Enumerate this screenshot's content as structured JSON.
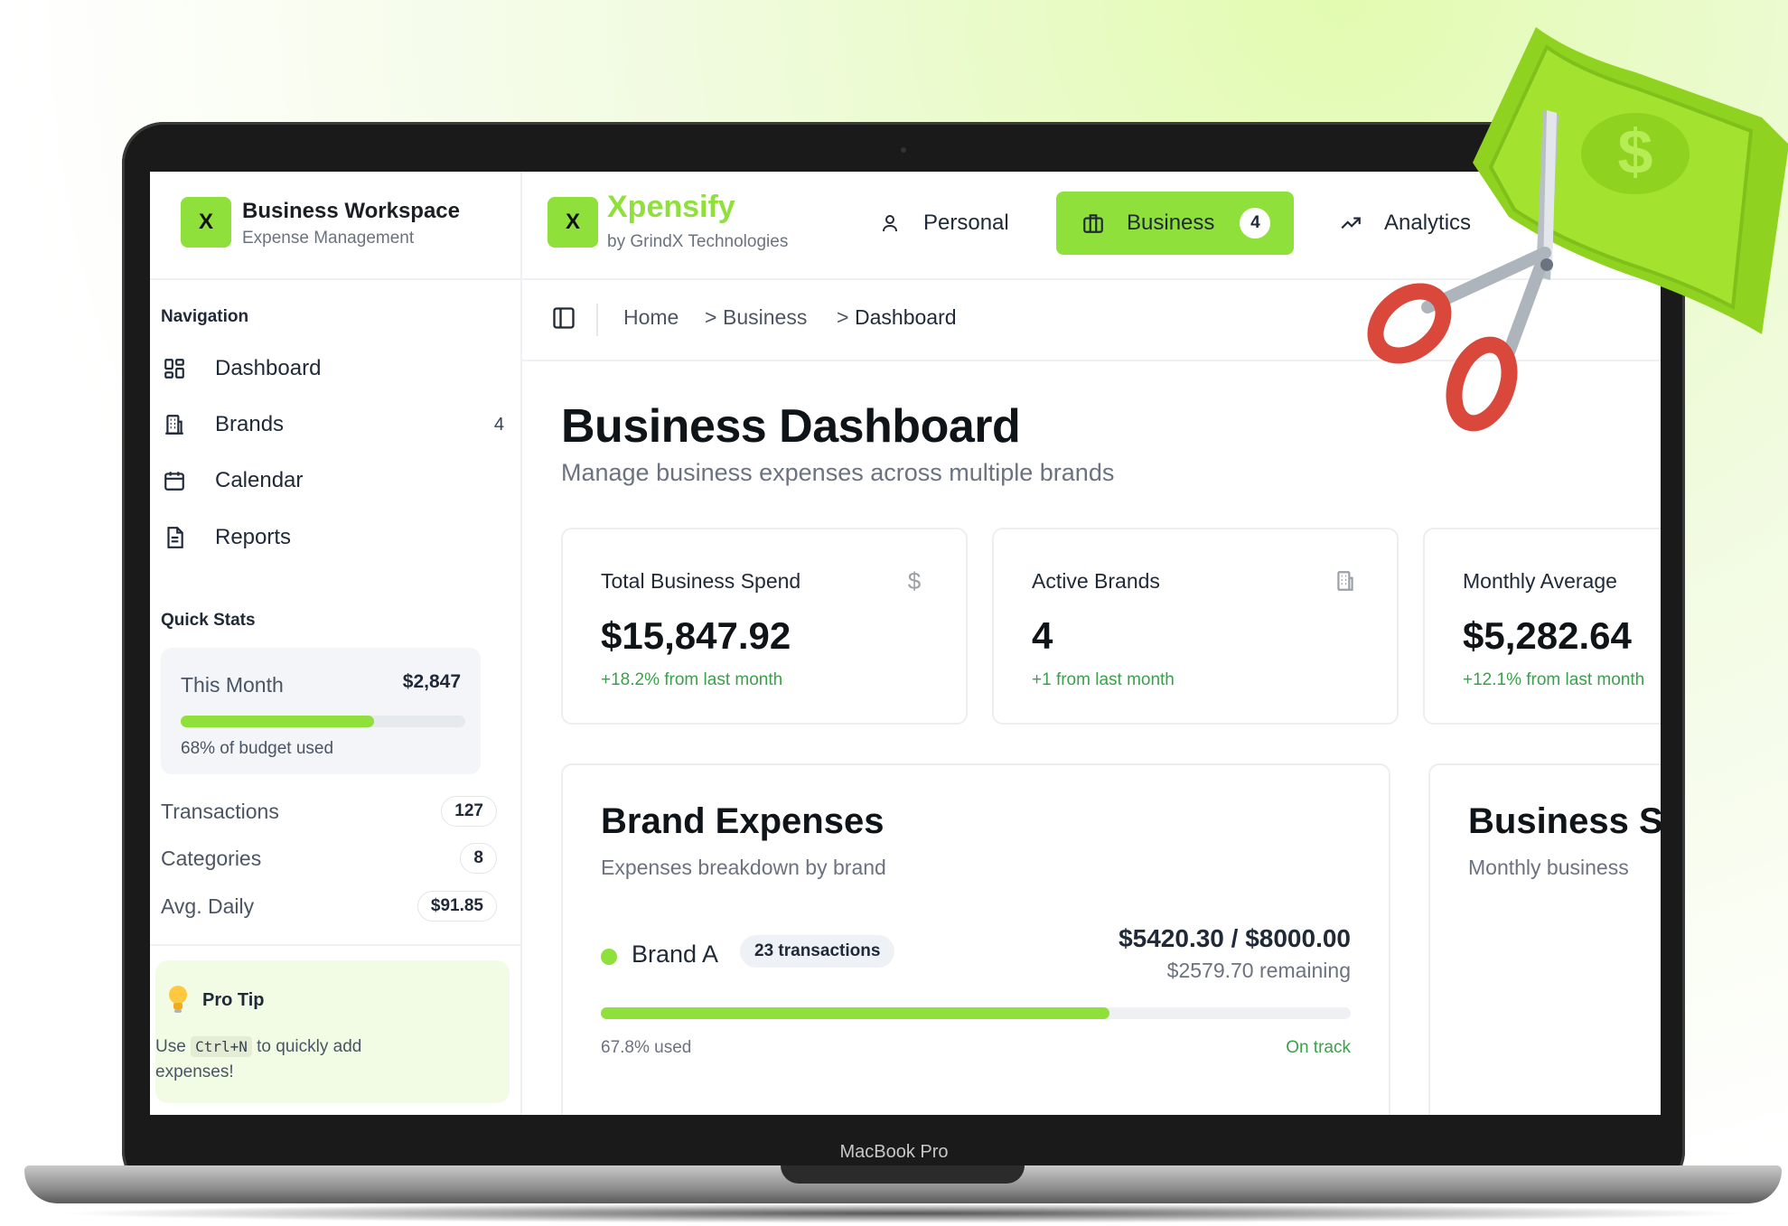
{
  "sidebar": {
    "logo_letter": "X",
    "workspace_title": "Business Workspace",
    "workspace_subtitle": "Expense Management",
    "navigation_label": "Navigation",
    "nav": [
      {
        "label": "Dashboard",
        "icon": "dashboard-icon",
        "count": ""
      },
      {
        "label": "Brands",
        "icon": "building-icon",
        "count": "4"
      },
      {
        "label": "Calendar",
        "icon": "calendar-icon",
        "count": ""
      },
      {
        "label": "Reports",
        "icon": "document-icon",
        "count": ""
      }
    ],
    "quick_stats_label": "Quick Stats",
    "this_month": {
      "label": "This Month",
      "value": "$2,847",
      "budget_used_pct": 68,
      "note": "68% of budget used"
    },
    "stats": [
      {
        "label": "Transactions",
        "value": "127"
      },
      {
        "label": "Categories",
        "value": "8"
      },
      {
        "label": "Avg. Daily",
        "value": "$91.85"
      }
    ],
    "pro_tip": {
      "title": "Pro Tip",
      "text_before": "Use ",
      "shortcut": "Ctrl+N",
      "text_after": " to quickly add expenses!"
    }
  },
  "topbar": {
    "logo_letter": "X",
    "brand_name": "Xpensify",
    "brand_by": "by GrindX Technologies",
    "tabs": [
      {
        "label": "Personal",
        "icon": "user-icon",
        "active": false
      },
      {
        "label": "Business",
        "icon": "briefcase-icon",
        "active": true,
        "badge": "4"
      },
      {
        "label": "Analytics",
        "icon": "trending-up-icon",
        "active": false
      }
    ]
  },
  "breadcrumb": {
    "items": [
      "Home",
      "Business",
      "Dashboard"
    ],
    "separator": ">"
  },
  "main": {
    "title": "Business Dashboard",
    "subtitle": "Manage business expenses across multiple brands",
    "stat_cards": [
      {
        "title": "Total Business Spend",
        "value": "$15,847.92",
        "change": "+18.2% from last month",
        "icon": "dollar-icon"
      },
      {
        "title": "Active Brands",
        "value": "4",
        "change": "+1 from last month",
        "icon": "building-icon"
      },
      {
        "title": "Monthly Average",
        "value": "$5,282.64",
        "change": "+12.1% from last month",
        "icon": ""
      }
    ],
    "brand_expenses": {
      "title": "Brand Expenses",
      "subtitle": "Expenses breakdown by brand",
      "brands": [
        {
          "name": "Brand A",
          "transactions": "23 transactions",
          "amount": "$5420.30 / $8000.00",
          "remaining": "$2579.70 remaining",
          "used_pct": 67.8,
          "used_label": "67.8% used",
          "status": "On track"
        }
      ]
    },
    "business_summary": {
      "title": "Business S",
      "subtitle": "Monthly business"
    }
  },
  "device": {
    "label": "MacBook Pro"
  },
  "colors": {
    "accent": "#8fe03a",
    "positive": "#3aa14a",
    "text": "#1f2937"
  }
}
